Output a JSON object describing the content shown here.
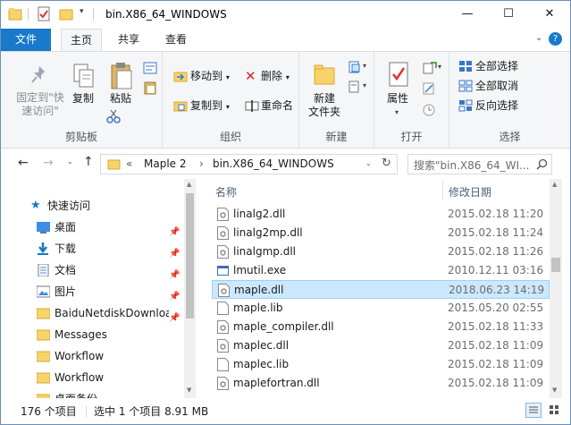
{
  "window": {
    "title": "bin.X86_64_WINDOWS",
    "minimize": "—",
    "maximize": "☐",
    "close": "✕"
  },
  "tabs": [
    {
      "label": "文件"
    },
    {
      "label": "主页"
    },
    {
      "label": "共享"
    },
    {
      "label": "查看"
    }
  ],
  "ribbon": {
    "clipboard": {
      "label": "剪贴板",
      "pin_line1": "固定到\"快",
      "pin_line2": "速访问\"",
      "copy": "复制",
      "paste": "粘贴"
    },
    "organize": {
      "label": "组织",
      "move_to": "移动到",
      "copy_to": "复制到",
      "delete": "删除",
      "rename": "重命名"
    },
    "new": {
      "label": "新建",
      "new_folder_line1": "新建",
      "new_folder_line2": "文件夹"
    },
    "open": {
      "label": "打开",
      "properties": "属性"
    },
    "select": {
      "label": "选择",
      "select_all": "全部选择",
      "select_none": "全部取消",
      "invert": "反向选择"
    }
  },
  "address": {
    "overflow": "«",
    "crumb1": "Maple 2",
    "sep": "›",
    "crumb2": "bin.X86_64_WINDOWS",
    "search_placeholder": "搜索\"bin.X86_64_WI..."
  },
  "nav": {
    "quick_access": "快速访问",
    "items": [
      {
        "label": "桌面",
        "pinned": true
      },
      {
        "label": "下载",
        "pinned": true
      },
      {
        "label": "文档",
        "pinned": true
      },
      {
        "label": "图片",
        "pinned": true
      },
      {
        "label": "BaiduNetdiskDownload",
        "pinned": true
      },
      {
        "label": "Messages",
        "pinned": false
      },
      {
        "label": "Workflow",
        "pinned": false
      },
      {
        "label": "Workflow",
        "pinned": false
      },
      {
        "label": "桌面备份",
        "pinned": false
      }
    ]
  },
  "columns": {
    "name": "名称",
    "date": "修改日期"
  },
  "files": [
    {
      "name": "linalg2.dll",
      "date": "2015.02.18 11:20",
      "type": "dll"
    },
    {
      "name": "linalg2mp.dll",
      "date": "2015.02.18 11:24",
      "type": "dll"
    },
    {
      "name": "linalgmp.dll",
      "date": "2015.02.18 11:26",
      "type": "dll"
    },
    {
      "name": "lmutil.exe",
      "date": "2010.12.11 03:16",
      "type": "exe"
    },
    {
      "name": "maple.dll",
      "date": "2018.06.23 14:19",
      "type": "dll",
      "selected": true
    },
    {
      "name": "maple.lib",
      "date": "2015.05.20 02:55",
      "type": "lib"
    },
    {
      "name": "maple_compiler.dll",
      "date": "2015.02.18 11:33",
      "type": "dll"
    },
    {
      "name": "maplec.dll",
      "date": "2015.02.18 11:09",
      "type": "dll"
    },
    {
      "name": "maplec.lib",
      "date": "2015.02.18 11:09",
      "type": "lib"
    },
    {
      "name": "maplefortran.dll",
      "date": "2015.02.18 11:09",
      "type": "dll"
    }
  ],
  "status": {
    "count": "176 个项目",
    "selection": "选中 1 个项目  8.91 MB"
  },
  "colors": {
    "accent": "#1979ca",
    "selected_row": "#cce8ff",
    "folder": "#f6d36b"
  }
}
